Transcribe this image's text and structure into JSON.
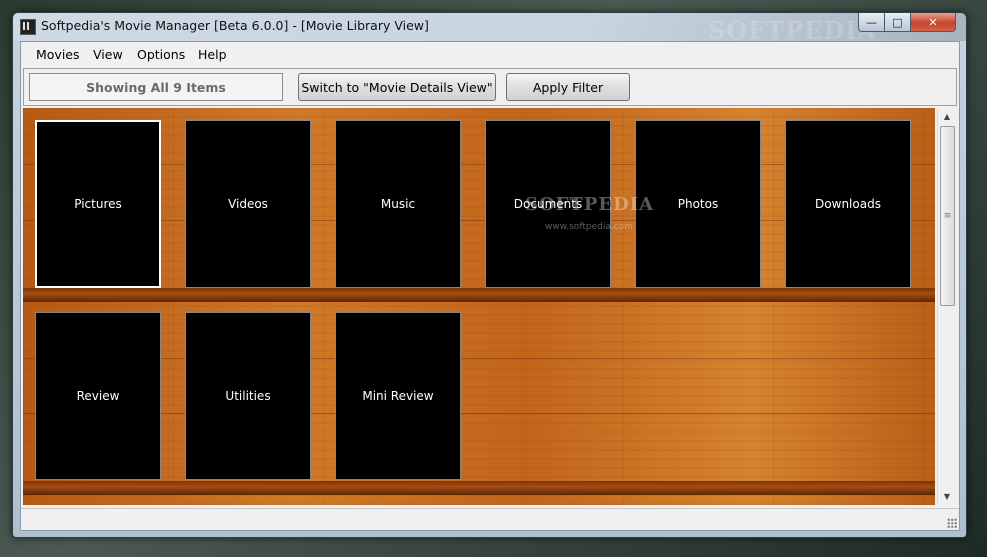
{
  "window": {
    "title": "Softpedia's Movie Manager [Beta 6.0.0] - [Movie Library View]",
    "watermark": "SOFTPEDIA",
    "controls": {
      "minimize": "—",
      "maximize": "□",
      "close": "✕"
    }
  },
  "menu": {
    "items": [
      "Movies",
      "View",
      "Options",
      "Help"
    ]
  },
  "toolbar": {
    "status": "Showing All 9 Items",
    "switch_label": "Switch to \"Movie Details View\"",
    "filter_label": "Apply Filter"
  },
  "library": {
    "tiles": [
      "Pictures",
      "Videos",
      "Music",
      "Documents",
      "Photos",
      "Downloads",
      "Review",
      "Utilities",
      "Mini Review"
    ],
    "watermark": "SOFTPEDIA",
    "watermark_sub": "www.softpedia.com"
  },
  "scrollbar": {
    "up": "▲",
    "down": "▼",
    "grip": "≡"
  }
}
